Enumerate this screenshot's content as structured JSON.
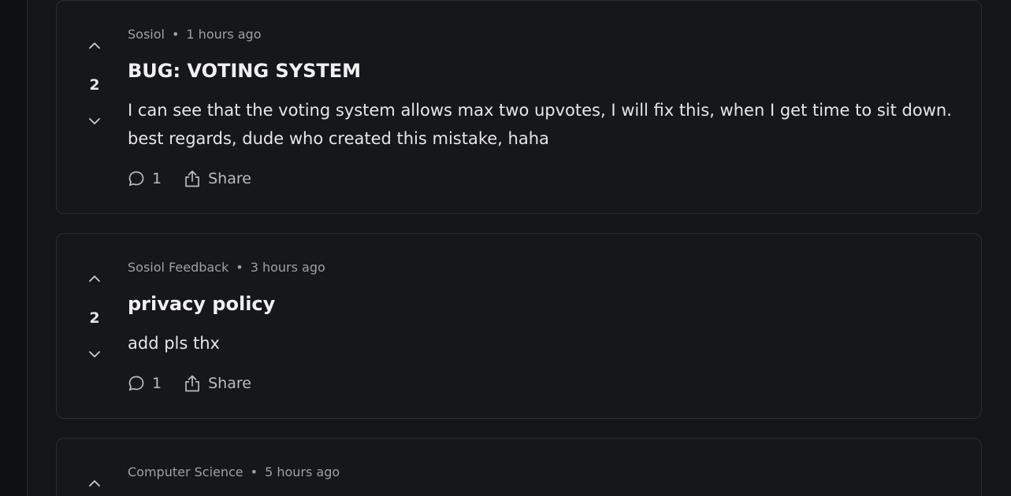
{
  "posts": [
    {
      "community": "Sosiol",
      "time": "1 hours ago",
      "votes": "2",
      "title": "BUG: VOTING SYSTEM",
      "body": "I can see that the voting system allows max two upvotes, I will fix this, when I get time to sit down. best regards, dude who created this mistake, haha",
      "comments": "1",
      "share_label": "Share"
    },
    {
      "community": "Sosiol Feedback",
      "time": "3 hours ago",
      "votes": "2",
      "title": "privacy policy",
      "body": "add pls thx",
      "comments": "1",
      "share_label": "Share"
    },
    {
      "community": "Computer Science",
      "time": "5 hours ago"
    }
  ],
  "meta_separator": "•",
  "icons": {
    "upvote": "chevron-up-icon",
    "downvote": "chevron-down-icon",
    "comment": "speech-bubble-icon",
    "share": "share-icon"
  },
  "colors": {
    "background": "#141519",
    "card": "#16171b",
    "card_border": "#2b2d33",
    "text": "#e6e6e6",
    "muted": "#9da0a6"
  }
}
